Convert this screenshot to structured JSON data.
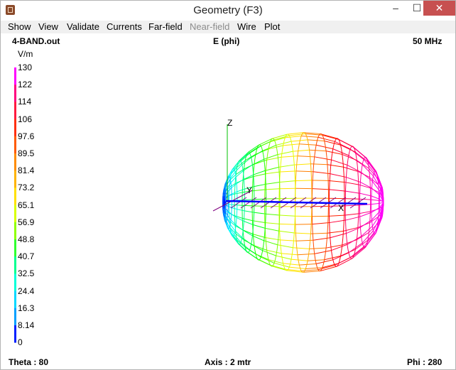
{
  "window": {
    "title": "Geometry   (F3)",
    "minimize": "–",
    "maximize": "☐",
    "close": "✕",
    "app_icon": "cube-icon"
  },
  "menu": [
    {
      "label": "Show",
      "enabled": true
    },
    {
      "label": "View",
      "enabled": true
    },
    {
      "label": "Validate",
      "enabled": true
    },
    {
      "label": "Currents",
      "enabled": true
    },
    {
      "label": "Far-field",
      "enabled": true
    },
    {
      "label": "Near-field",
      "enabled": false
    },
    {
      "label": "Wire",
      "enabled": true
    },
    {
      "label": "Plot",
      "enabled": true
    }
  ],
  "header": {
    "file": "4-BAND.out",
    "quantity": "E (phi)",
    "frequency": "50 MHz"
  },
  "scale": {
    "unit": "V/m",
    "ticks": [
      "130",
      "122",
      "114",
      "106",
      "97.6",
      "89.5",
      "81.4",
      "73.2",
      "65.1",
      "56.9",
      "48.8",
      "40.7",
      "32.5",
      "24.4",
      "16.3",
      "8.14",
      "0"
    ],
    "colors": [
      "#ff00ff",
      "#ff0080",
      "#ff1a40",
      "#ff3010",
      "#ff5a00",
      "#ff8c00",
      "#ffb400",
      "#ffe000",
      "#d8ff00",
      "#90ff00",
      "#30ff30",
      "#00ff90",
      "#00ffd8",
      "#00d8ff",
      "#00a0ff",
      "#0020ff"
    ]
  },
  "axes": {
    "x": "X",
    "y": "Y",
    "z": "Z"
  },
  "status": {
    "theta": "Theta : 80",
    "axis": "Axis : 2 mtr",
    "phi": "Phi : 280"
  }
}
